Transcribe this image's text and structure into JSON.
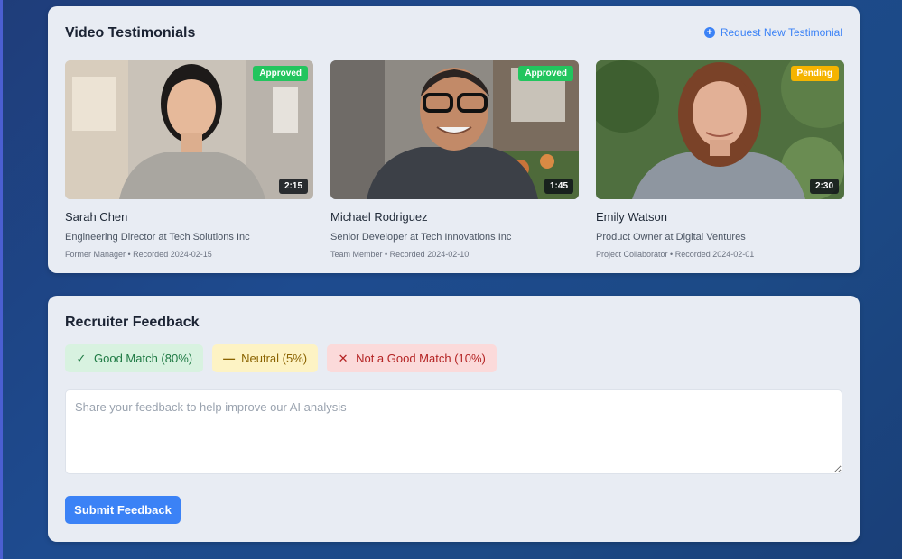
{
  "testimonials": {
    "title": "Video Testimonials",
    "request_label": "Request New Testimonial",
    "request_icon": "plus-circle-icon",
    "videos": [
      {
        "name": "Sarah Chen",
        "role": "Engineering Director at Tech Solutions Inc",
        "meta": "Former Manager • Recorded 2024-02-15",
        "status": "Approved",
        "duration": "2:15"
      },
      {
        "name": "Michael Rodriguez",
        "role": "Senior Developer at Tech Innovations Inc",
        "meta": "Team Member • Recorded 2024-02-10",
        "status": "Approved",
        "duration": "1:45"
      },
      {
        "name": "Emily Watson",
        "role": "Product Owner at Digital Ventures",
        "meta": "Project Collaborator • Recorded 2024-02-01",
        "status": "Pending",
        "duration": "2:30"
      }
    ]
  },
  "feedback": {
    "title": "Recruiter Feedback",
    "options": [
      {
        "label": "Good Match (80%)",
        "icon": "check-icon"
      },
      {
        "label": "Neutral (5%)",
        "icon": "minus-icon"
      },
      {
        "label": "Not a Good Match (10%)",
        "icon": "x-icon"
      }
    ],
    "placeholder": "Share your feedback to help improve our AI analysis",
    "value": "",
    "submit_label": "Submit Feedback"
  },
  "colors": {
    "accent": "#3b82f6",
    "approved": "#22c55e",
    "pending": "#f5b400",
    "good": "#1f7a44",
    "neutral": "#8a6300",
    "bad": "#b42323"
  }
}
